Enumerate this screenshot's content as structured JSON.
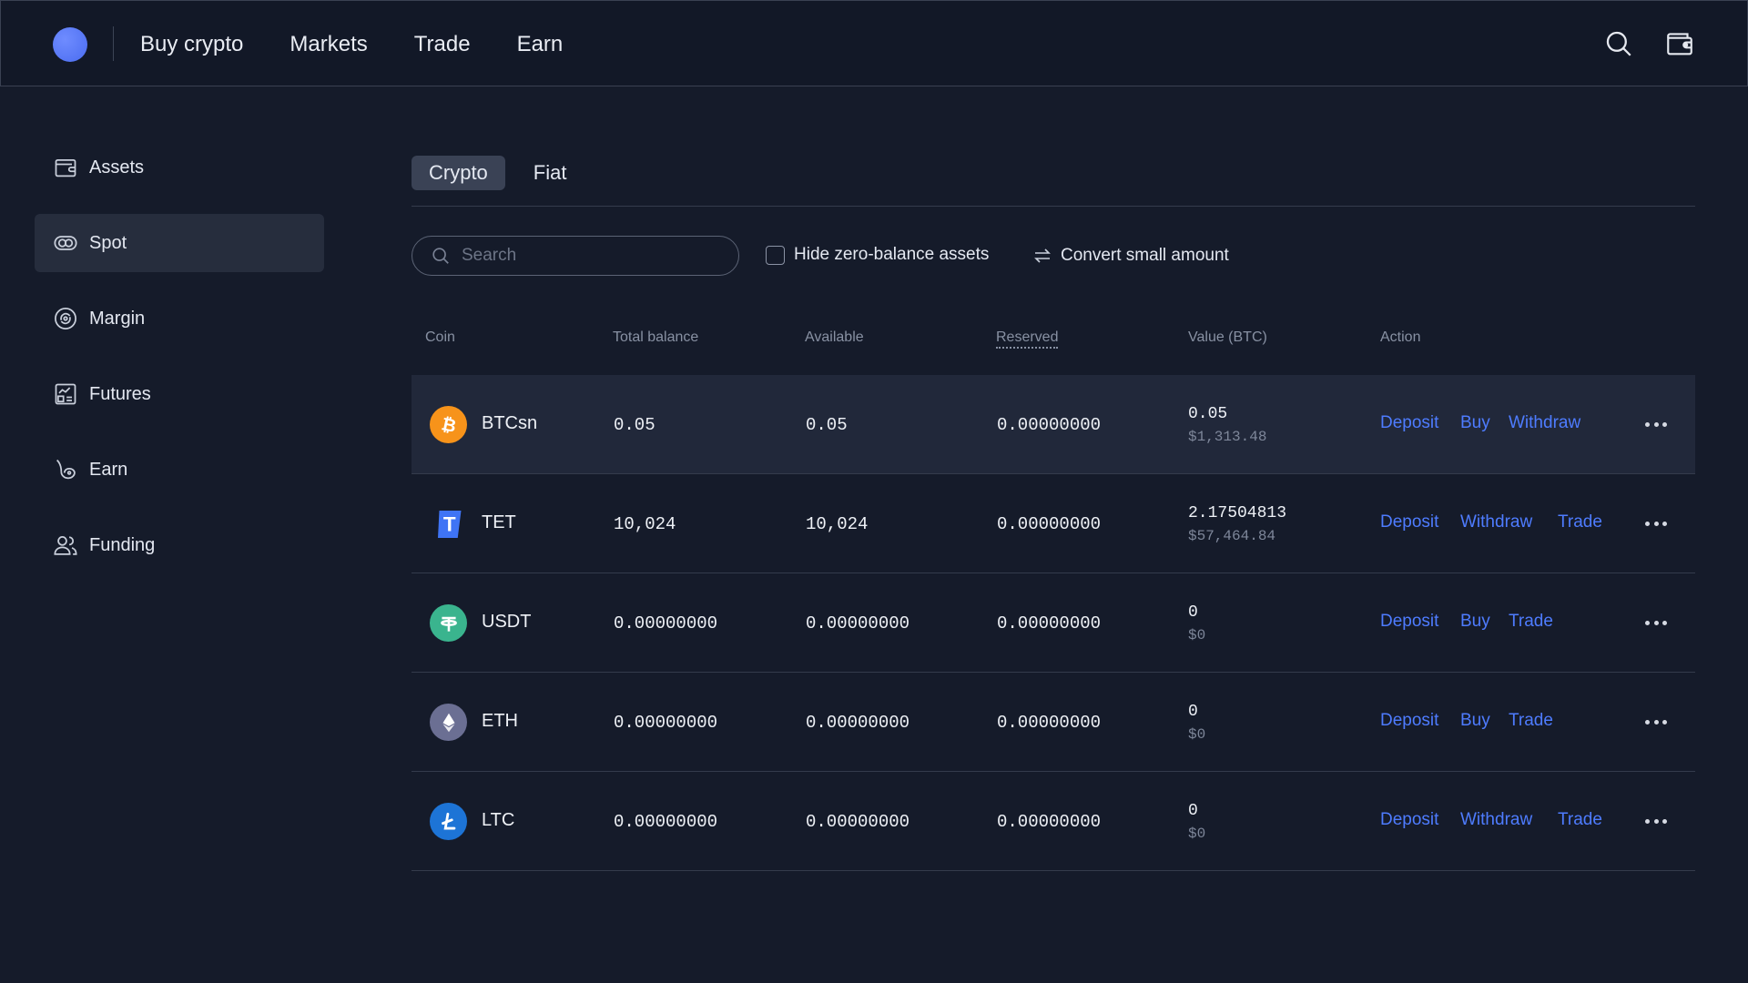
{
  "topbar": {
    "nav": [
      "Buy crypto",
      "Markets",
      "Trade",
      "Earn"
    ],
    "icons": [
      "search-icon",
      "wallet-icon"
    ]
  },
  "sidebar": {
    "items": [
      {
        "label": "Assets",
        "icon": "wallet-icon",
        "active": false
      },
      {
        "label": "Spot",
        "icon": "spot-icon",
        "active": true
      },
      {
        "label": "Margin",
        "icon": "margin-icon",
        "active": false
      },
      {
        "label": "Futures",
        "icon": "futures-icon",
        "active": false
      },
      {
        "label": "Earn",
        "icon": "earn-icon",
        "active": false
      },
      {
        "label": "Funding",
        "icon": "funding-icon",
        "active": false
      }
    ]
  },
  "tabs": [
    {
      "label": "Crypto",
      "active": true
    },
    {
      "label": "Fiat",
      "active": false
    }
  ],
  "filters": {
    "search_placeholder": "Search",
    "hide_zero_label": "Hide zero-balance assets",
    "convert_label": "Convert small amount"
  },
  "table": {
    "headers": {
      "coin": "Coin",
      "total": "Total balance",
      "available": "Available",
      "reserved": "Reserved",
      "value": "Value (BTC)",
      "action": "Action"
    },
    "rows": [
      {
        "coin": "BTCsn",
        "icon": "bitcoin-icon",
        "color": "#f7931a",
        "total": "0.05",
        "available": "0.05",
        "reserved": "0.00000000",
        "value_btc": "0.05",
        "value_usd": "$1,313.48",
        "actions": [
          "Deposit",
          "Buy",
          "Withdraw"
        ]
      },
      {
        "coin": "TET",
        "icon": "tet-icon",
        "color": "#3f74f5",
        "total": "10,024",
        "available": "10,024",
        "reserved": "0.00000000",
        "value_btc": "2.17504813",
        "value_usd": "$57,464.84",
        "actions": [
          "Deposit",
          "Withdraw",
          "Trade"
        ]
      },
      {
        "coin": "USDT",
        "icon": "tether-icon",
        "color": "#3ab48e",
        "total": "0.00000000",
        "available": "0.00000000",
        "reserved": "0.00000000",
        "value_btc": "0",
        "value_usd": "$0",
        "actions": [
          "Deposit",
          "Buy",
          "Trade"
        ]
      },
      {
        "coin": "ETH",
        "icon": "ethereum-icon",
        "color": "#6b6f93",
        "total": "0.00000000",
        "available": "0.00000000",
        "reserved": "0.00000000",
        "value_btc": "0",
        "value_usd": "$0",
        "actions": [
          "Deposit",
          "Buy",
          "Trade"
        ]
      },
      {
        "coin": "LTC",
        "icon": "litecoin-icon",
        "color": "#1d74d6",
        "total": "0.00000000",
        "available": "0.00000000",
        "reserved": "0.00000000",
        "value_btc": "0",
        "value_usd": "$0",
        "actions": [
          "Deposit",
          "Withdraw",
          "Trade"
        ]
      }
    ]
  },
  "colors": {
    "accent": "#4e7cff",
    "background": "#151b2a",
    "highlight_row": "#21283a"
  }
}
